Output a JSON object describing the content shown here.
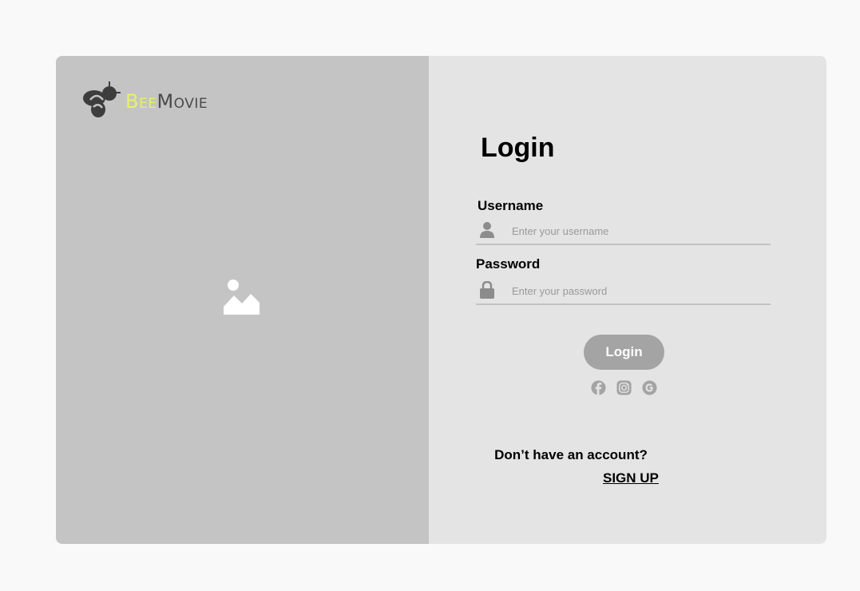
{
  "logo": {
    "bee": "Bee",
    "movie": "Movie"
  },
  "login_form": {
    "title": "Login",
    "username": {
      "label": "Username",
      "placeholder": "Enter your username",
      "value": ""
    },
    "password": {
      "label": "Password",
      "placeholder": "Enter your password",
      "value": ""
    },
    "submit_label": "Login"
  },
  "social_icons": [
    "facebook-icon",
    "instagram-icon",
    "google-icon"
  ],
  "signup": {
    "prompt": "Don’t have an account?",
    "link_label": "SIGN UP"
  },
  "colors": {
    "page_background": "#f9f9f9",
    "left_panel": "#c4c4c4",
    "right_panel": "#e4e4e4",
    "accent_bee": "#e8f06a",
    "button": "#a4a4a4",
    "icon_gray": "#8c8c8c"
  }
}
